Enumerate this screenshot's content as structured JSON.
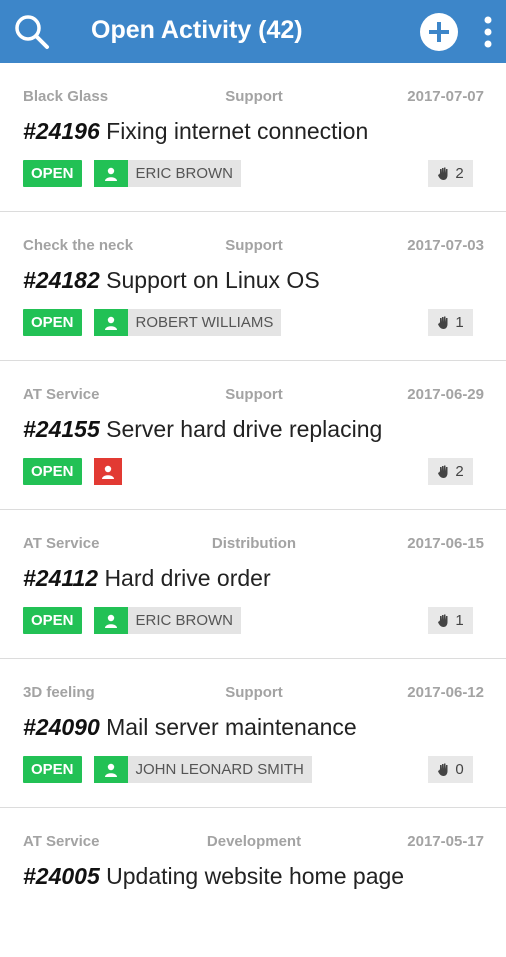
{
  "appbar": {
    "title": "Open Activity (42)",
    "search_icon": "search-icon",
    "add_icon": "add-circle-icon",
    "more_icon": "more-vert-icon"
  },
  "colors": {
    "appbar": "#3d86c9",
    "open_status": "#22c155",
    "unassigned": "#e23a33",
    "meta_text": "#a3a3a3"
  },
  "items": [
    {
      "client": "Black Glass",
      "category": "Support",
      "date": "2017-07-07",
      "number": "#24196",
      "subject": "Fixing internet connection",
      "status": "OPEN",
      "assignee": "ERIC BROWN",
      "count": "2"
    },
    {
      "client": "Check the neck",
      "category": "Support",
      "date": "2017-07-03",
      "number": "#24182",
      "subject": "Support on Linux OS",
      "status": "OPEN",
      "assignee": "ROBERT WILLIAMS",
      "count": "1"
    },
    {
      "client": "AT Service",
      "category": "Support",
      "date": "2017-06-29",
      "number": "#24155",
      "subject": "Server hard drive replacing",
      "status": "OPEN",
      "assignee": "",
      "count": "2"
    },
    {
      "client": "AT Service",
      "category": "Distribution",
      "date": "2017-06-15",
      "number": "#24112",
      "subject": "Hard drive order",
      "status": "OPEN",
      "assignee": "ERIC BROWN",
      "count": "1"
    },
    {
      "client": "3D feeling",
      "category": "Support",
      "date": "2017-06-12",
      "number": "#24090",
      "subject": "Mail server maintenance",
      "status": "OPEN",
      "assignee": "JOHN LEONARD SMITH",
      "count": "0"
    },
    {
      "client": "AT Service",
      "category": "Development",
      "date": "2017-05-17",
      "number": "#24005",
      "subject": "Updating website home page",
      "status": "",
      "assignee": "",
      "count": ""
    }
  ]
}
